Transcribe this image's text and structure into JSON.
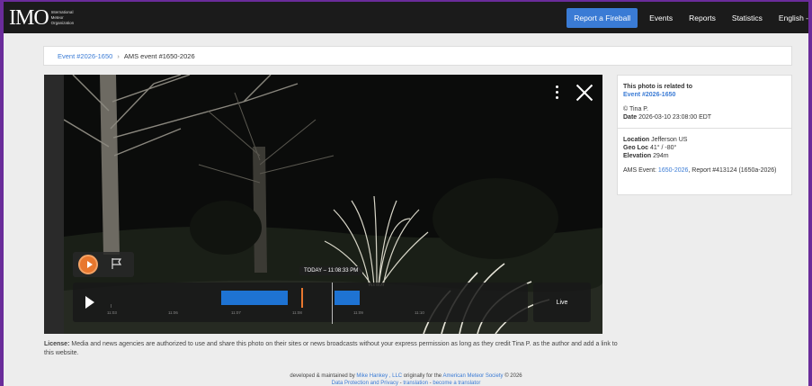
{
  "header": {
    "logo_text": "IMO",
    "logo_sub": "International Meteor Organization",
    "report_button": "Report a Fireball",
    "nav": [
      "Events",
      "Reports",
      "Statistics",
      "English -"
    ]
  },
  "breadcrumb": {
    "event_link": "Event #2026-1650",
    "current": "AMS event #1650-2026"
  },
  "player": {
    "timestamp": "TODAY – 11:08:33 PM",
    "live_label": "Live",
    "timeline_labels": [
      "11:03",
      "11:06",
      "11:07",
      "11:08",
      "11:09",
      "11:10"
    ]
  },
  "sidebar": {
    "related_label": "This photo is related to",
    "related_link": "Event #2026-1650",
    "credit": "© Tina P.",
    "date_label": "Date",
    "date_value": "2026-03-10 23:08:00 EDT",
    "location_label": "Location",
    "location_value": "Jefferson US",
    "geoloc_label": "Geo Loc",
    "geoloc_value": "41° / -80°",
    "elevation_label": "Elevation",
    "elevation_value": "294m",
    "ams_prefix": "AMS Event:",
    "ams_link": "1650-2026",
    "ams_suffix": ", Report #413124 (1650a-2026)"
  },
  "license": {
    "label": "License:",
    "text": "Media and news agencies are authorized to use and share this photo on their sites or news broadcasts without your express permission as long as they credit Tina P. as the author and add a link to this website."
  },
  "footer": {
    "line1_a": "developed & maintained by",
    "link_mike": "Mike Hankey , LLC",
    "line1_b": "originally for the",
    "link_ams": "American Meteor Society",
    "line1_c": "© 2026",
    "link_privacy": "Data Protection and Privacy",
    "sep1": " - ",
    "link_translation": "translation",
    "sep2": " - ",
    "link_translator": "become a translator"
  },
  "colors": {
    "accent": "#3a7bd5",
    "frame": "#6a2c9a",
    "marker": "#e8772e"
  }
}
